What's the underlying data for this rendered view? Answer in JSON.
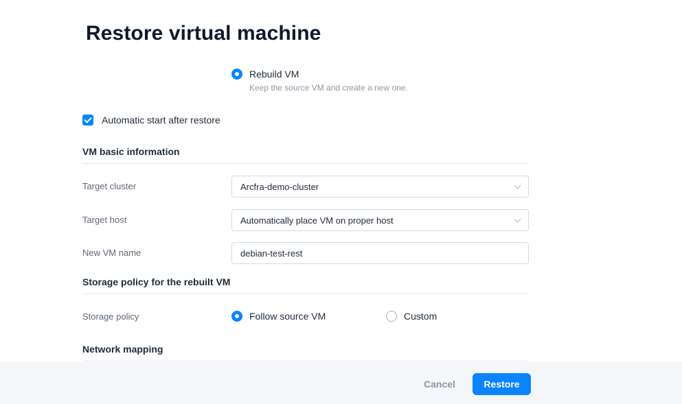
{
  "dialog": {
    "title": "Restore virtual machine"
  },
  "restore_mode": {
    "selected": "rebuild",
    "rebuild_label": "Rebuild VM",
    "rebuild_description": "Keep the source VM and create a new one."
  },
  "auto_start": {
    "label": "Automatic start after restore",
    "checked": true
  },
  "basic_info": {
    "heading": "VM basic information",
    "target_cluster": {
      "label": "Target cluster",
      "value": "Arcfra-demo-cluster"
    },
    "target_host": {
      "label": "Target host",
      "value": "Automatically place VM on proper host"
    },
    "vm_name": {
      "label": "New VM name",
      "value": "debian-test-rest"
    }
  },
  "storage": {
    "heading": "Storage policy for the rebuilt VM",
    "label": "Storage policy",
    "options": [
      "Follow source VM",
      "Custom"
    ],
    "selected": "Follow source VM"
  },
  "network": {
    "heading": "Network mapping"
  },
  "footer": {
    "cancel_label": "Cancel",
    "restore_label": "Restore"
  },
  "colors": {
    "accent": "#0a84ff",
    "footer_bg": "#f4f6f9",
    "title": "#0d1a2c"
  }
}
